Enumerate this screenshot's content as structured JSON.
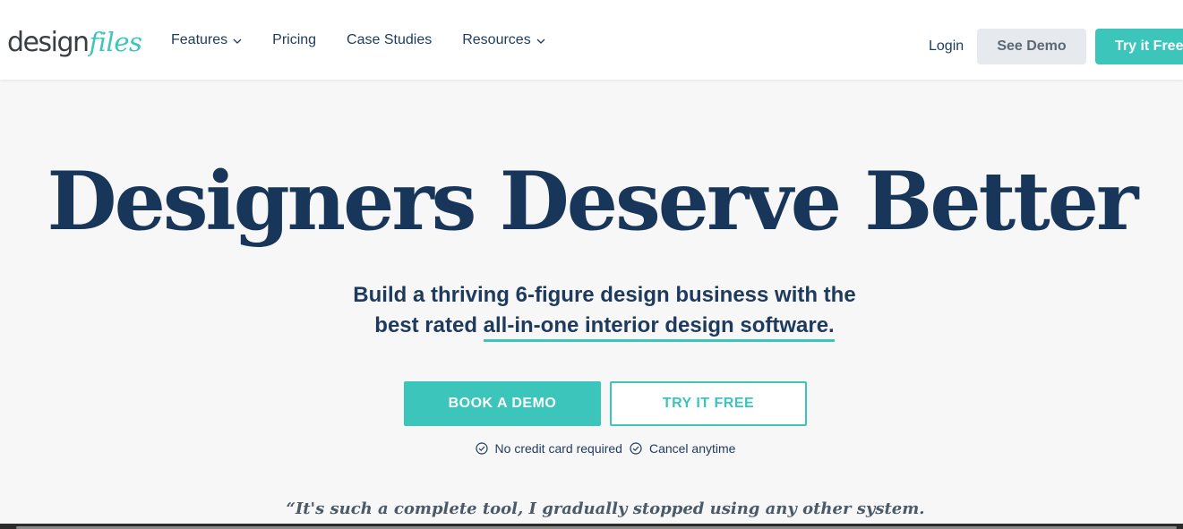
{
  "brand": {
    "logo_part1": "design",
    "logo_part2": "files",
    "accent_color": "#3bc5bb",
    "navy_color": "#17365a"
  },
  "nav": {
    "items": [
      {
        "label": "Features",
        "has_dropdown": true
      },
      {
        "label": "Pricing",
        "has_dropdown": false
      },
      {
        "label": "Case Studies",
        "has_dropdown": false
      },
      {
        "label": "Resources",
        "has_dropdown": true
      }
    ],
    "login_label": "Login",
    "see_demo_label": "See Demo",
    "try_free_label": "Try it Free"
  },
  "hero": {
    "title": "Designers Deserve Better",
    "subtitle_line1": "Build a thriving 6-figure design business with the",
    "subtitle_line2_prefix": "best rated ",
    "subtitle_line2_highlight": "all-in-one interior design software."
  },
  "cta": {
    "book_demo_label": "BOOK A DEMO",
    "try_free_label": "TRY IT FREE"
  },
  "perks": [
    {
      "icon": "check-circle-icon",
      "label": "No credit card required"
    },
    {
      "icon": "check-circle-icon",
      "label": "Cancel anytime"
    }
  ],
  "testimonial": {
    "quote": "“It's such a complete tool, I gradually stopped using any other system."
  }
}
